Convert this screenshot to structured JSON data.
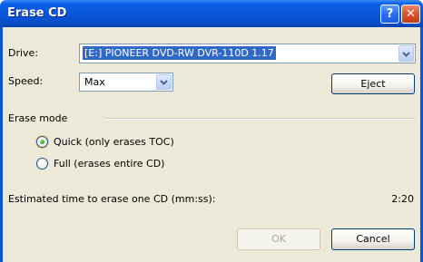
{
  "window": {
    "title": "Erase CD",
    "help_glyph": "?",
    "close_glyph": "✕"
  },
  "drive": {
    "label": "Drive:",
    "value": "[E:] PIONEER DVD-RW  DVR-110D 1.17"
  },
  "speed": {
    "label": "Speed:",
    "value": "Max"
  },
  "eject_label": "Eject",
  "erase_mode": {
    "label": "Erase mode",
    "options": [
      {
        "label": "Quick (only erases TOC)",
        "selected": true
      },
      {
        "label": "Full (erases entire CD)",
        "selected": false
      }
    ]
  },
  "estimate": {
    "label": "Estimated time to erase one CD (mm:ss):",
    "value": "2:20"
  },
  "buttons": {
    "ok_label": "OK",
    "ok_enabled": false,
    "cancel_label": "Cancel"
  },
  "colors": {
    "titlebar": "#0a54d6",
    "dialog_bg": "#ece9d8",
    "selection": "#316ac5",
    "close_button": "#d9532e",
    "radio_selected": "#21a121"
  },
  "icons": {
    "dropdown": "chevron-down-icon",
    "help": "help-icon",
    "close": "close-icon"
  }
}
